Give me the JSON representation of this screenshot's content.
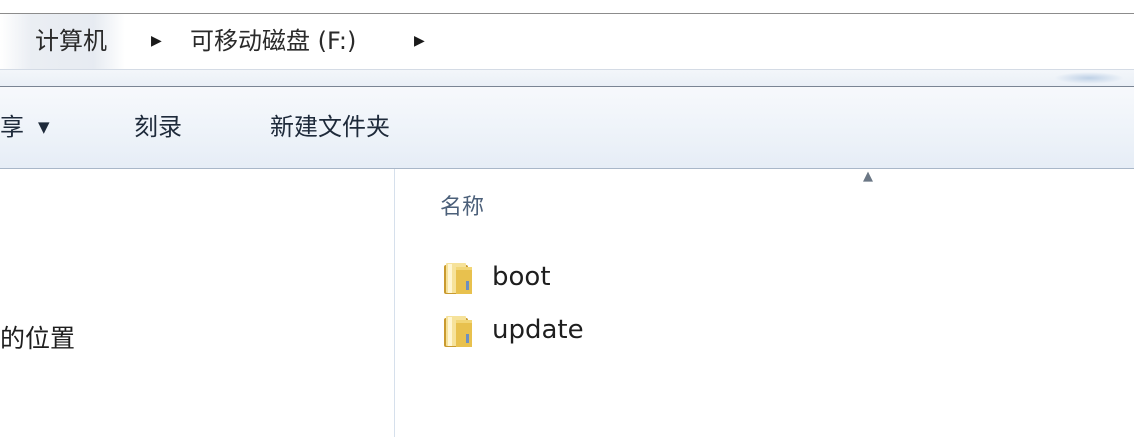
{
  "address_bar": {
    "breadcrumbs": [
      {
        "label": "计算机"
      },
      {
        "label": "可移动磁盘 (F:)"
      }
    ],
    "separator_icon": "triangle-right-icon"
  },
  "toolbar": {
    "share_label": "享",
    "share_dropdown_icon": "triangle-down-icon",
    "burn_label": "刻录",
    "new_folder_label": "新建文件夹"
  },
  "navigation": {
    "items": [
      {
        "label": "的位置"
      }
    ]
  },
  "file_list": {
    "column_header": "名称",
    "sort_indicator_icon": "sort-ascending-icon",
    "items": [
      {
        "name": "boot",
        "icon": "folder-icon"
      },
      {
        "name": "update",
        "icon": "folder-icon"
      }
    ]
  },
  "colors": {
    "toolbar_top": "#f7f9fc",
    "toolbar_bottom": "#e6edf6",
    "header_text": "#4c607a",
    "folder_yellow": "#e8c14e"
  }
}
